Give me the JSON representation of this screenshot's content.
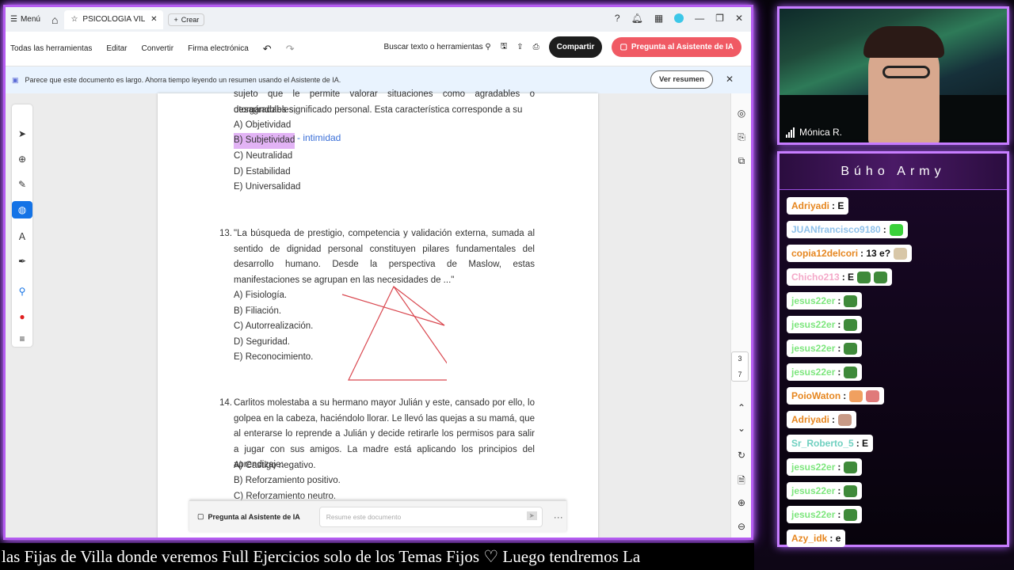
{
  "browser": {
    "menu_label": "Menú",
    "tab_title": "PSICOLOGÍA VILLAR...",
    "new_tab_label": "Crear"
  },
  "toolbar": {
    "all_tools": "Todas las herramientas",
    "edit": "Editar",
    "convert": "Convertir",
    "esign": "Firma electrónica",
    "search": "Buscar texto o herramientas",
    "share": "Compartir",
    "ask_ai": "Pregunta al Asistente de IA"
  },
  "banner": {
    "text": "Parece que este documento es largo. Ahorra tiempo leyendo un resumen usando el Asistente de IA.",
    "view_summary": "Ver resumen"
  },
  "doc": {
    "q12_tail_1": "sujeto que le permite valorar situaciones como agradables o desagradables,",
    "q12_tail_2": "otorgándoles significado personal. Esta característica corresponde a su",
    "q12_options": [
      "A)  Objetividad",
      "B)  Subjetividad",
      "C)  Neutralidad",
      "D)  Estabilidad",
      "E)  Universalidad"
    ],
    "q12_note": "- intimidad",
    "q13_num": "13.",
    "q13_text": "\"La búsqueda de prestigio, competencia y validación externa, sumada al sentido de dignidad personal constituyen pilares fundamentales del desarrollo humano. Desde la perspectiva de Maslow, estas manifestaciones se agrupan en las necesidades de ...\"",
    "q13_options": [
      "A)  Fisiología.",
      "B)  Filiación.",
      "C)  Autorrealización.",
      "D)  Seguridad.",
      "E)  Reconocimiento."
    ],
    "q14_num": "14.",
    "q14_text": "Carlitos molestaba a su hermano mayor Julián y este, cansado por ello, lo golpea en la cabeza, haciéndolo llorar. Le llevó las quejas a su mamá, que al enterarse lo reprende a Julián y decide retirarle los permisos para salir a jugar con sus amigos. La madre está aplicando los principios del aprendizaje:",
    "q14_options": [
      "A)  Castigo negativo.",
      "B)  Reforzamiento positivo.",
      "C)  Reforzamiento neutro."
    ]
  },
  "ai_bar": {
    "label": "Pregunta al Asistente de IA",
    "placeholder": "Resume este documento",
    "more": "···"
  },
  "page_indicator": {
    "current": "3",
    "total": "7"
  },
  "webcam": {
    "name": "Mónica R."
  },
  "chat": {
    "title": "Búho Army",
    "messages": [
      {
        "user": "Adriyadi",
        "color": "#e6861f",
        "text": ": E",
        "emotes": []
      },
      {
        "user": "JUANfrancisco9180",
        "color": "#8fc1ea",
        "text": ":",
        "emotes": [
          "#3bd13b"
        ]
      },
      {
        "user": "copia12delcori",
        "color": "#e6861f",
        "text": ": 13 e?",
        "emotes": [
          "#d8c7a8"
        ]
      },
      {
        "user": "Chicho213",
        "color": "#f4a8c8",
        "text": ": E",
        "emotes": [
          "#3f8a3a",
          "#3f8a3a"
        ]
      },
      {
        "user": "jesus22er",
        "color": "#7de67d",
        "text": ":",
        "emotes": [
          "#3f8a3a"
        ]
      },
      {
        "user": "jesus22er",
        "color": "#7de67d",
        "text": ":",
        "emotes": [
          "#3f8a3a"
        ]
      },
      {
        "user": "jesus22er",
        "color": "#7de67d",
        "text": ":",
        "emotes": [
          "#3f8a3a"
        ]
      },
      {
        "user": "jesus22er",
        "color": "#7de67d",
        "text": ":",
        "emotes": [
          "#3f8a3a"
        ]
      },
      {
        "user": "PoioWaton",
        "color": "#e6861f",
        "text": ":",
        "emotes": [
          "#f0a060",
          "#e07a7a"
        ]
      },
      {
        "user": "Adriyadi",
        "color": "#e6861f",
        "text": ":",
        "emotes": [
          "#c89a86"
        ]
      },
      {
        "user": "Sr_Roberto_5",
        "color": "#6fd0c0",
        "text": ": E",
        "emotes": []
      },
      {
        "user": "jesus22er",
        "color": "#7de67d",
        "text": ":",
        "emotes": [
          "#3f8a3a"
        ]
      },
      {
        "user": "jesus22er",
        "color": "#7de67d",
        "text": ":",
        "emotes": [
          "#3f8a3a"
        ]
      },
      {
        "user": "jesus22er",
        "color": "#7de67d",
        "text": ":",
        "emotes": [
          "#3f8a3a"
        ]
      },
      {
        "user": "Azy_idk",
        "color": "#e6861f",
        "text": ": e",
        "emotes": []
      }
    ]
  },
  "ticker": {
    "text": "las Fijas de Villa donde veremos Full Ejercicios solo de los Temas Fijos    ♡   Luego tendremos La"
  },
  "colors": {
    "accent": "#c77dff",
    "ai_button": "#f05a64",
    "highlight": "#e2b3f5",
    "triangle": "#d9474f"
  }
}
